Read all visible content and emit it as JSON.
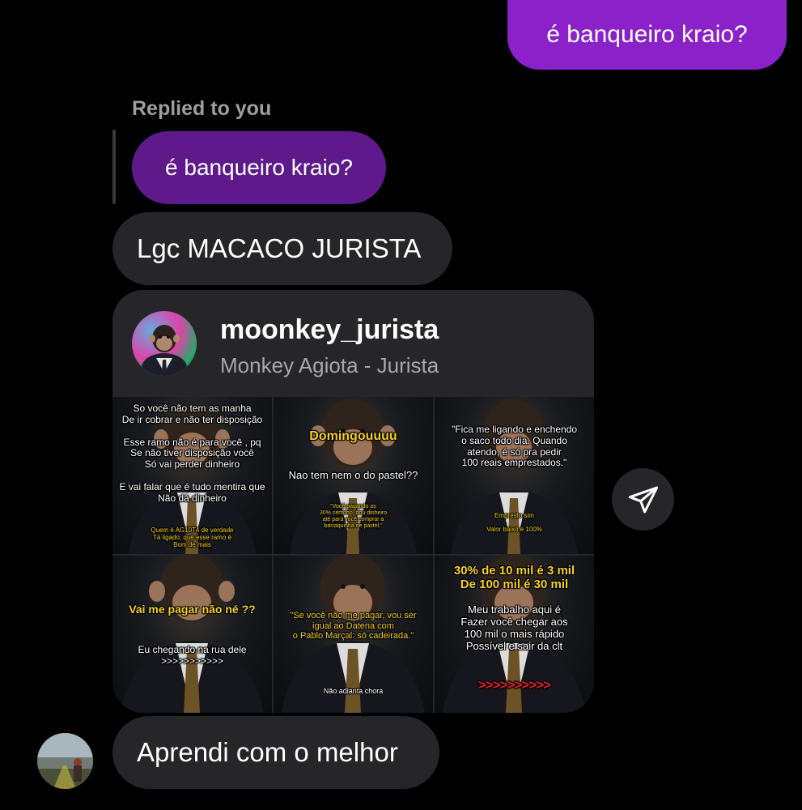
{
  "messages": {
    "sent_top": "é banqueiro kraio?",
    "replied_label": "Replied to you",
    "reply_quote": "é banqueiro kraio?",
    "reply_text": "Lgc MACACO JURISTA",
    "last_text": "Aprendi com o melhor"
  },
  "shared_profile": {
    "username": "moonkey_jurista",
    "full_name": "Monkey Agiota - Jurista",
    "posts": [
      {
        "lines": [
          "So você não tem as manha",
          "De ir cobrar e não ter disposição",
          "",
          "Esse ramo não é para você , pq",
          "Se não tiver disposição você",
          "Só vai perder dinheiro",
          "",
          "E vai falar que é tudo mentira que",
          "Não dá dinheiro"
        ],
        "small_lines": [
          "Quem é AG10T4 de verdade",
          "Tá ligado, que esse ramo é",
          "Bom de mais"
        ]
      },
      {
        "headline": "Domingouuuu",
        "line": "Nao tem nem o do pastel??",
        "small_lines": [
          "\"Você pagando os",
          "30% certinho, dou dinheiro",
          "até para você comprar a",
          "barraquinha de pastel.\""
        ]
      },
      {
        "lines": [
          "\"Fica me ligando e enchendo",
          "o saco todo dia. Quando",
          "atendo, é só pra pedir",
          "100 reais emprestados.\""
        ],
        "small_lines": [
          "Empresto sim",
          "Valor baixo e 100%"
        ]
      },
      {
        "headline": "Vai me pagar não né ??",
        "lines": [
          "Eu chegando na rua dele",
          ">>>>>>>>>>>"
        ]
      },
      {
        "lines": [
          "\"Se você não me pagar, vou ser",
          "igual ao Datena com",
          "o Pablo Marçal: só cadeirada.\""
        ],
        "small_lines": [
          "Não adianta chora"
        ]
      },
      {
        "headlines": [
          "30% de 10 mil é 3 mil",
          "De 100 mil é 30 mil"
        ],
        "lines": [
          "Meu trabalho aqui é",
          "Fazer você chegar  aos",
          "100 mil o mais rápido",
          "Possível e sair da clt"
        ],
        "arrows": ">>>>>>>>>>"
      }
    ]
  },
  "icons": {
    "send": "paper-plane-icon",
    "avatar": "user-avatar"
  },
  "colors": {
    "sent_bubble": "#8a21c9",
    "reply_quote_bubble": "#5e1a8b",
    "received_bubble": "#262628",
    "background": "#000000"
  }
}
